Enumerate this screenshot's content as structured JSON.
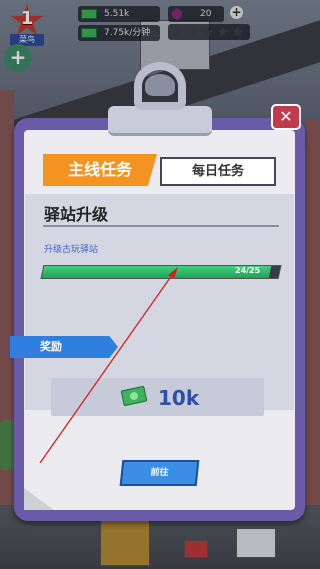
{
  "hud": {
    "level": "1",
    "level_name": "菜鸟",
    "cash": "5.51k",
    "income": "7.75k/分钟",
    "gems": "20"
  },
  "dialog": {
    "tab_main": "主线任务",
    "tab_daily": "每日任务",
    "task_title": "驿站升级",
    "task_desc": "升级古玩驿站",
    "progress_text": "24/25",
    "progress_fraction": 0.96,
    "reward_label": "奖励",
    "reward_value": "10k",
    "go_button": "前往",
    "close_symbol": "✕"
  },
  "colors": {
    "accent": "#f39422",
    "board": "#6a5ba8",
    "progress_green": "#1fa25a",
    "button_blue": "#3c8de4",
    "annotation_arrow": "#d42020"
  }
}
